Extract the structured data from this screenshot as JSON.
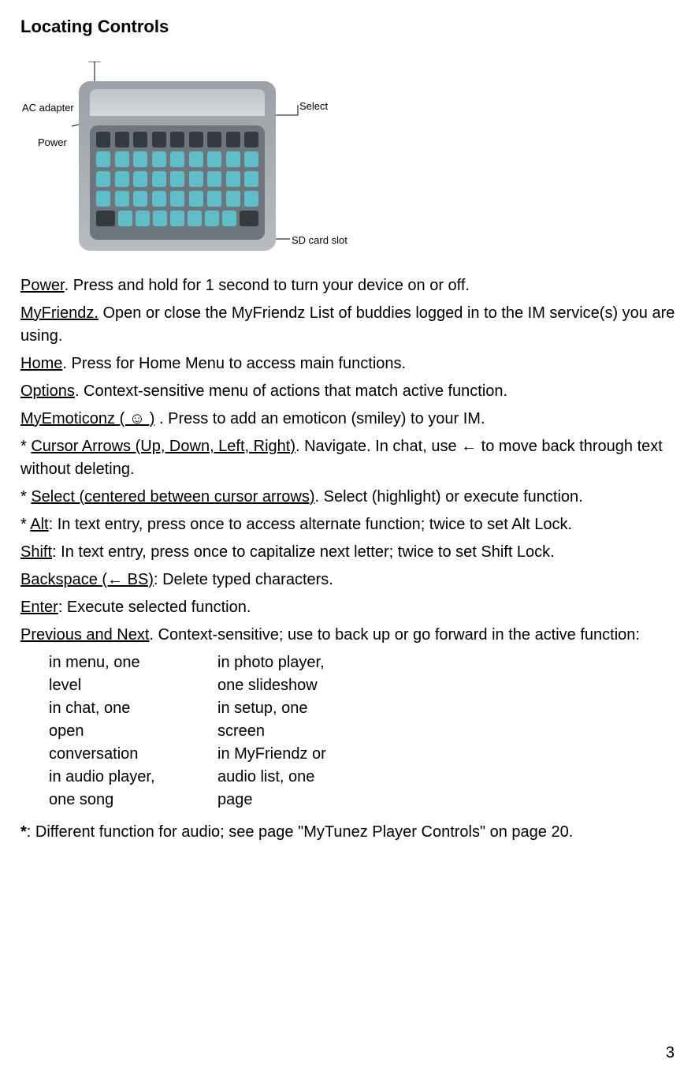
{
  "heading": "Locating Controls",
  "diagram": {
    "ac_adapter": "AC adapter",
    "power": "Power",
    "select": "Select",
    "sd_slot": "SD card slot"
  },
  "entries": {
    "power_term": "Power",
    "power_desc": ".    Press and hold for 1 second to turn your device on or off.",
    "myfriendz_term": "MyFriendz.",
    "myfriendz_desc": "    Open or close the MyFriendz List of buddies logged in to the IM service(s) you are using.",
    "home_term": "Home",
    "home_desc": ".    Press for Home Menu to access main functions.",
    "options_term": "Options",
    "options_desc": ".    Context-sensitive menu of actions that match active function.",
    "emoticonz_term": "MyEmoticonz ( ☺ )",
    "emoticonz_desc": " . Press to add an emoticon (smiley) to your IM.",
    "cursor_pre": "*   ",
    "cursor_term": "Cursor Arrows (Up, Down, Left, Right)",
    "cursor_desc": ".    Navigate.    In chat, use ← to move back through text without deleting.",
    "select_pre": "*   ",
    "select_term": "Select (centered between cursor arrows)",
    "select_desc": ".    Select (highlight) or execute function.",
    "alt_pre": "*   ",
    "alt_term": "Alt",
    "alt_desc": ":    In text entry, press once to access alternate function; twice to set Alt Lock.",
    "shift_term": "Shift",
    "shift_desc": ":    In text entry, press once to capitalize next letter; twice to set Shift Lock.",
    "bs_term": "Backspace (← BS)",
    "bs_desc": ":    Delete typed characters.",
    "enter_term": "Enter",
    "enter_desc": ":    Execute selected function.",
    "pn_term": "Previous and Next",
    "pn_desc": ".    Context-sensitive; use to back up or go forward in the active function:"
  },
  "columns": {
    "left": {
      "l1": "in menu, one",
      "l2": "level",
      "l3": "in chat, one",
      "l4": "open",
      "l5": "conversation",
      "l6": "in audio player,",
      "l7": "one song"
    },
    "right": {
      "r1": "in photo player,",
      "r2": "one slideshow",
      "r3": "in setup, one",
      "r4": "screen",
      "r5": "in MyFriendz or",
      "r6": "audio list, one",
      "r7": "page"
    }
  },
  "footnote": {
    "star": "*",
    "desc": ":    Different function for audio; see page \"MyTunez Player Controls\" on page 20."
  },
  "page_number": "3"
}
